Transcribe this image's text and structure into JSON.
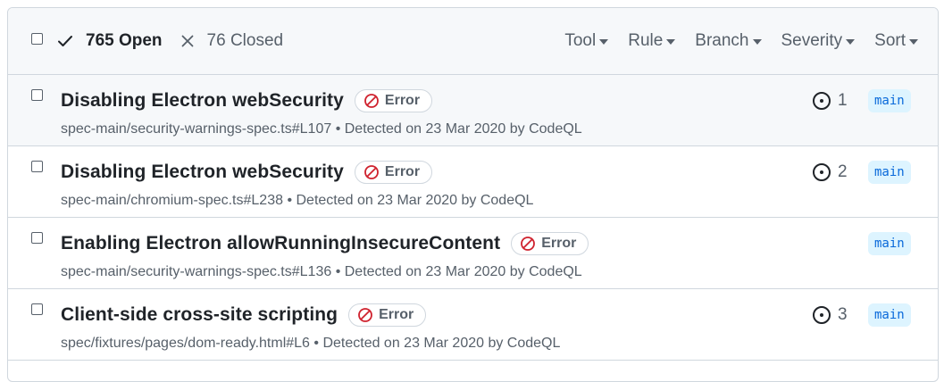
{
  "header": {
    "open_label": "765 Open",
    "closed_label": "76 Closed",
    "filters": [
      "Tool",
      "Rule",
      "Branch",
      "Severity",
      "Sort"
    ]
  },
  "alerts": [
    {
      "title": "Disabling Electron webSecurity",
      "severity": "Error",
      "path": "spec-main/security-warnings-spec.ts#L107",
      "detected": " • Detected on 23 Mar 2020 by CodeQL",
      "count": "1",
      "branch": "main"
    },
    {
      "title": "Disabling Electron webSecurity",
      "severity": "Error",
      "path": "spec-main/chromium-spec.ts#L238",
      "detected": " • Detected on 23 Mar 2020 by CodeQL",
      "count": "2",
      "branch": "main"
    },
    {
      "title": "Enabling Electron allowRunningInsecureContent",
      "severity": "Error",
      "path": "spec-main/security-warnings-spec.ts#L136",
      "detected": " • Detected on 23 Mar 2020 by CodeQL",
      "count": "",
      "branch": "main"
    },
    {
      "title": "Client-side cross-site scripting",
      "severity": "Error",
      "path": "spec/fixtures/pages/dom-ready.html#L6",
      "detected": " • Detected on 23 Mar 2020 by CodeQL",
      "count": "3",
      "branch": "main"
    }
  ],
  "colors": {
    "error_icon": "#cf222e",
    "branch_bg": "#ddf4ff",
    "branch_text": "#0969da"
  }
}
